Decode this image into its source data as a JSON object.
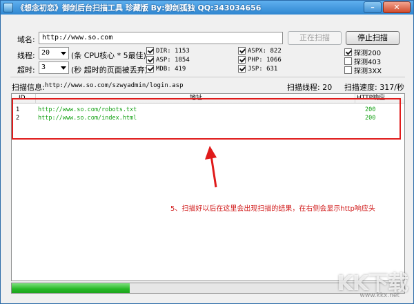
{
  "window": {
    "title": "《想念初恋》御剑后台扫描工具 珍藏版 By:御剑孤独 QQ:343034656"
  },
  "domain": {
    "label": "域名:",
    "value": "http://www.so.com"
  },
  "buttons": {
    "scanning": "正在扫描",
    "stop": "停止扫描"
  },
  "threads": {
    "label": "线程:",
    "value": "20",
    "hint": "(条 CPU核心 * 5最佳)"
  },
  "timeout": {
    "label": "超时:",
    "value": "3",
    "hint": "(秒 超时的页面被丢弃)"
  },
  "dictionaries": [
    {
      "label": "DIR: 1153",
      "checked": true
    },
    {
      "label": "ASP: 1854",
      "checked": true
    },
    {
      "label": "MDB: 419",
      "checked": true
    },
    {
      "label": "ASPX: 822",
      "checked": true
    },
    {
      "label": "PHP: 1066",
      "checked": true
    },
    {
      "label": "JSP: 631",
      "checked": true
    }
  ],
  "detect": [
    {
      "label": "探测200",
      "checked": true
    },
    {
      "label": "探测403",
      "checked": false
    },
    {
      "label": "探测3XX",
      "checked": false
    }
  ],
  "status": {
    "info_label": "扫描信息:",
    "info_value": "http://www.so.com/szwyadmin/login.asp",
    "threads": "扫描线程: 20",
    "speed": "扫描速度: 317/秒"
  },
  "results": {
    "columns": [
      "ID",
      "地址",
      "HTTP响应"
    ],
    "rows": [
      {
        "id": "1",
        "url": "http://www.so.com/robots.txt",
        "code": "200"
      },
      {
        "id": "2",
        "url": "http://www.so.com/index.html",
        "code": "200"
      }
    ]
  },
  "annotation": "5、扫描好以后在这里会出现扫描的结果，在右侧会显示http响应头",
  "progress": {
    "fraction": 0.3
  },
  "watermark": {
    "logo": "KK下载",
    "url": "www.kkx.net"
  },
  "colors": {
    "annotation": "#e01b1b",
    "result_text": "#12a012",
    "progress": "#27b827"
  }
}
